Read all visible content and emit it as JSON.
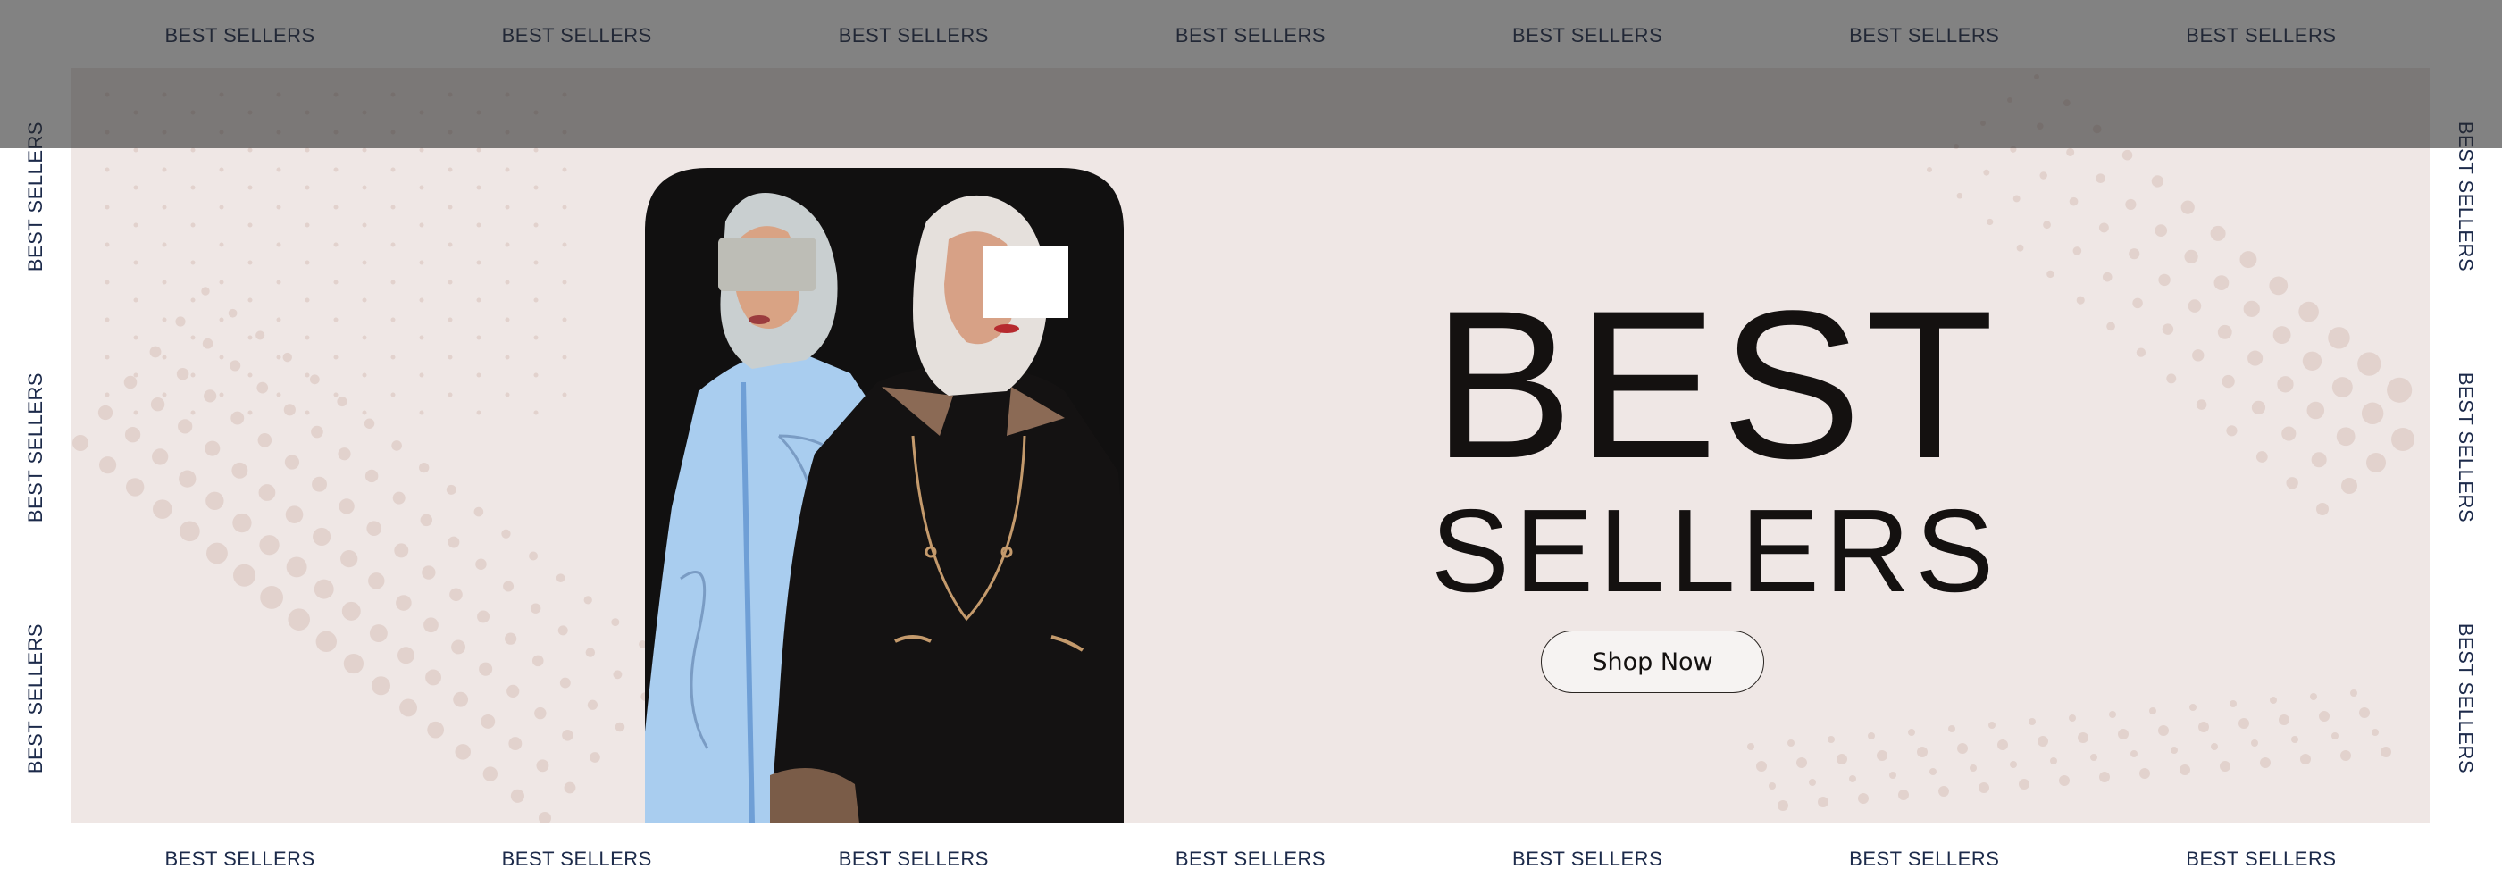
{
  "marquee": {
    "text": "BEST SELLERS",
    "top": [
      "BEST SELLERS",
      "BEST SELLERS",
      "BEST SELLERS",
      "BEST SELLERS",
      "BEST SELLERS",
      "BEST SELLERS",
      "BEST SELLERS"
    ],
    "bottom": [
      "BEST SELLERS",
      "BEST SELLERS",
      "BEST SELLERS",
      "BEST SELLERS",
      "BEST SELLERS",
      "BEST SELLERS",
      "BEST SELLERS"
    ],
    "left": [
      "BEST SELLERS",
      "BEST SELLERS",
      "BEST SELLERS"
    ],
    "right": [
      "BEST SELLERS",
      "BEST SELLERS",
      "BEST SELLERS"
    ]
  },
  "hero": {
    "title_line1": "BEST",
    "title_line2": "SELLERS",
    "cta_label": "Shop Now",
    "background_color": "#efe7e5",
    "text_color": "#141110",
    "dot_color": "#e2d2cd",
    "overlay_color": "#4a4a4a"
  },
  "icons": {
    "photo": "model-photo"
  }
}
